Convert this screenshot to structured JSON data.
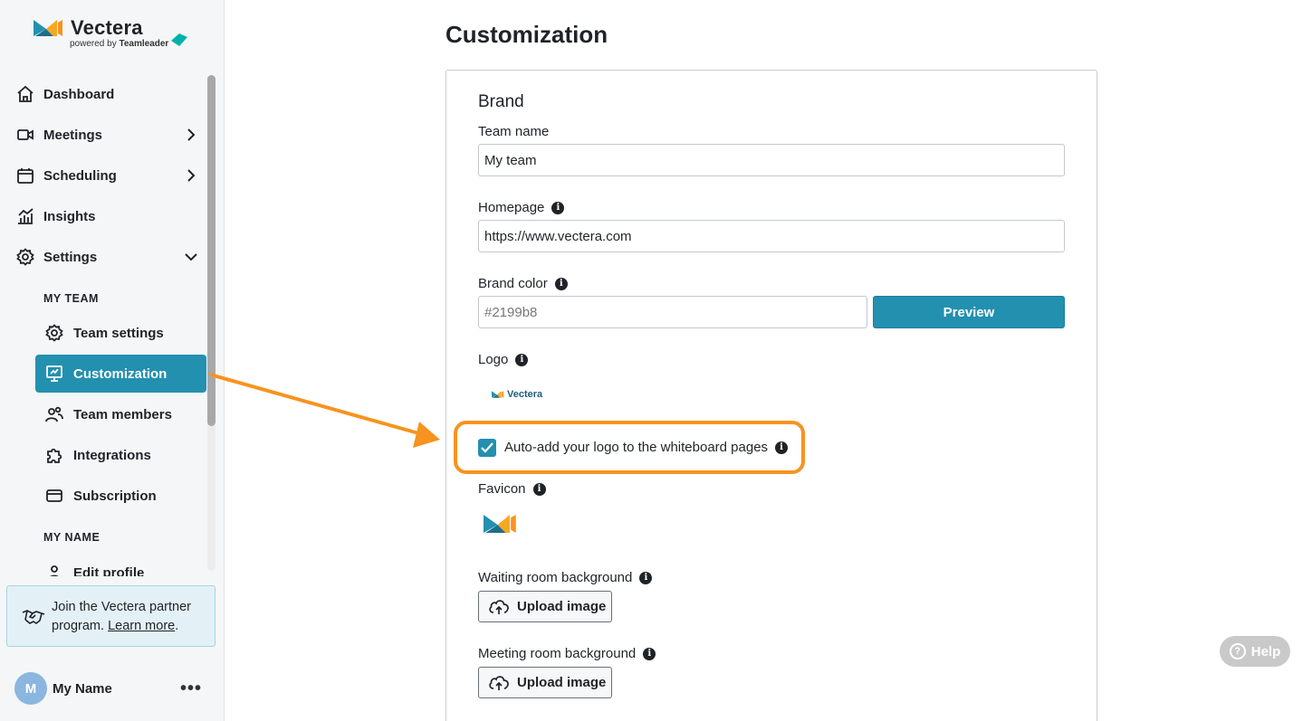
{
  "brand": {
    "name": "Vectera",
    "powered_prefix": "powered by",
    "powered_brand": "Teamleader"
  },
  "sidebar": {
    "nav": [
      {
        "label": "Dashboard",
        "icon": "home-icon"
      },
      {
        "label": "Meetings",
        "icon": "video-camera-icon",
        "chevron": "right"
      },
      {
        "label": "Scheduling",
        "icon": "calendar-icon",
        "chevron": "right"
      },
      {
        "label": "Insights",
        "icon": "chart-icon"
      },
      {
        "label": "Settings",
        "icon": "gear-icon",
        "chevron": "down"
      }
    ],
    "my_team_heading": "MY TEAM",
    "team_items": [
      {
        "label": "Team settings",
        "icon": "gear-icon"
      },
      {
        "label": "Customization",
        "icon": "presentation-board-icon",
        "active": true
      },
      {
        "label": "Team members",
        "icon": "users-icon"
      },
      {
        "label": "Integrations",
        "icon": "puzzle-icon"
      },
      {
        "label": "Subscription",
        "icon": "credit-card-icon"
      }
    ],
    "my_name_heading": "MY NAME",
    "name_items": [
      {
        "label": "Edit profile",
        "icon": "person-icon"
      }
    ],
    "partner": {
      "text": "Join the Vectera partner program.",
      "link": "Learn more",
      "suffix": "."
    },
    "user": {
      "initial": "M",
      "name": "My Name",
      "menu": "•••"
    }
  },
  "main": {
    "title": "Customization",
    "section_title": "Brand",
    "team_name": {
      "label": "Team name",
      "value": "My team"
    },
    "homepage": {
      "label": "Homepage",
      "value": "https://www.vectera.com"
    },
    "brand_color": {
      "label": "Brand color",
      "placeholder": "#2199b8",
      "button": "Preview"
    },
    "logo": {
      "label": "Logo",
      "image_text": "Vectera"
    },
    "auto_logo": {
      "label": "Auto-add your logo to the whiteboard pages",
      "checked": true
    },
    "favicon": {
      "label": "Favicon"
    },
    "waiting_room": {
      "label": "Waiting room background",
      "button": "Upload image"
    },
    "meeting_room": {
      "label": "Meeting room background",
      "button": "Upload image"
    }
  },
  "help": {
    "label": "Help",
    "icon": "?"
  },
  "colors": {
    "accent": "#2390b0",
    "highlight": "#f7931e",
    "brand_color_value": "#2199b8"
  }
}
